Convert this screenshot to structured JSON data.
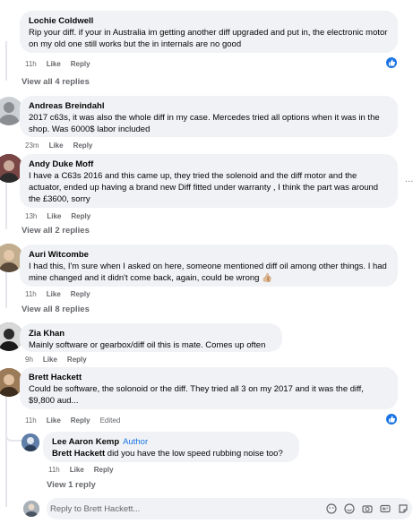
{
  "comments": [
    {
      "author": "Lochie Coldwell",
      "text": "Rip your diff. if your in Australia im getting another diff upgraded and put in, the electronic motor on my old one still works but the in internals are no good",
      "time": "11h",
      "like": "Like",
      "reply": "Reply",
      "view_replies": "View all 4 replies"
    },
    {
      "author": "Andreas Breindahl",
      "text": "2017 c63s, it was also the whole diff in my case. Mercedes tried all options when it was in the shop. Was 6000$ labor included",
      "time": "23m",
      "like": "Like",
      "reply": "Reply"
    },
    {
      "author": "Andy Duke Moff",
      "text": "I have a C63s 2016 and this came up, they tried the solenoid and the diff motor and the actuator, ended up having a brand new Diff fitted under warranty , I think the part was around the £3600, sorry",
      "time": "13h",
      "like": "Like",
      "reply": "Reply",
      "view_replies": "View all 2 replies",
      "more": "..."
    },
    {
      "author": "Auri Witcombe",
      "text": "I had this, I'm sure when I asked on here, someone mentioned diff oil among other things. I had mine changed and it didn't come back, again, could be wrong 👍🏼",
      "time": "11h",
      "like": "Like",
      "reply": "Reply",
      "view_replies": "View all 8 replies"
    },
    {
      "author": "Zia Khan",
      "text": "Mainly software or gearbox/diff oil this is mate. Comes up often",
      "time": "9h",
      "like": "Like",
      "reply": "Reply"
    },
    {
      "author": "Brett Hackett",
      "text": "Could be software, the solonoid or the diff. They tried all 3 on my 2017 and it was the diff, $9,800 aud...",
      "time": "11h",
      "like": "Like",
      "reply": "Reply",
      "edited": "Edited"
    }
  ],
  "nested_reply": {
    "author": "Lee Aaron Kemp",
    "badge": "Author",
    "mention": "Brett Hackett",
    "text": " did you have the low speed rubbing noise too?",
    "time": "11h",
    "like": "Like",
    "reply": "Reply",
    "view_replies": "View 1 reply"
  },
  "reply_box": {
    "placeholder": "Reply to Brett Hackett..."
  },
  "colors": {
    "like_blue": "#1b74e4",
    "bubble_bg": "#f0f2f5",
    "meta_gray": "#65676b"
  },
  "icons": [
    "like-icon",
    "avatar-sticker-icon",
    "emoji-icon",
    "camera-icon",
    "gif-icon",
    "sticker-icon"
  ]
}
